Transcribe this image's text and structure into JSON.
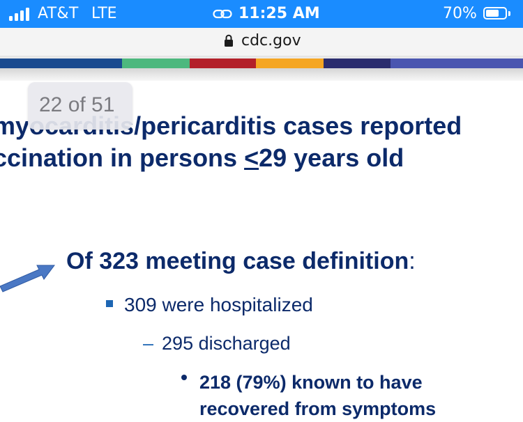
{
  "status_bar": {
    "carrier": "AT&T",
    "network": "LTE",
    "time": "11:25 AM",
    "battery_percent": "70%",
    "battery_level": 0.7,
    "signal_bars": 4
  },
  "browser": {
    "url": "cdc.gov",
    "lock_icon": "lock-icon"
  },
  "slide": {
    "brand_colors": [
      "#1a4a8f",
      "#4db87e",
      "#b3202a",
      "#f5a623",
      "#2b2d6e",
      "#4a56b0"
    ],
    "page_counter": "22 of 51",
    "title_line1": "myocarditis/pericarditis cases reported",
    "title_line2_prefix": "ccination in persons ",
    "title_line2_underlined": "<",
    "title_line2_suffix": "29 years old",
    "heading_text": "Of 323 meeting case definition",
    "heading_colon": ":",
    "bullet_hospitalized": "309 were hospitalized",
    "sub_bullet_discharged": "295 discharged",
    "sub_sub_bullet_line1": "218 (79%) known to have",
    "sub_sub_bullet_line2": "recovered from symptoms"
  }
}
